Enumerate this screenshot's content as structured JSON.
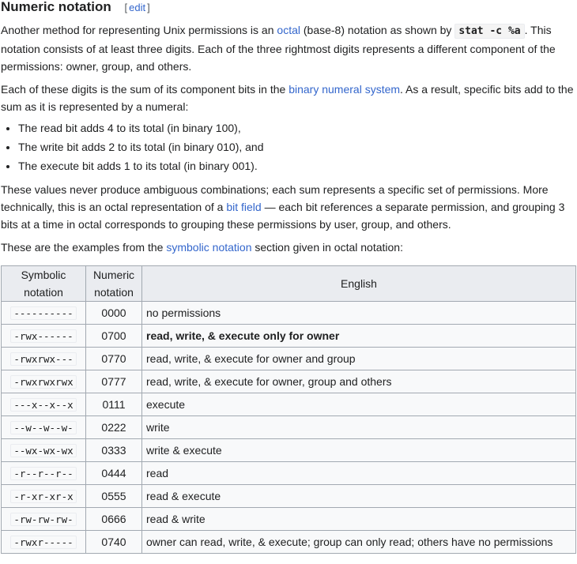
{
  "heading": {
    "title": "Numeric notation",
    "edit_open": "[",
    "edit_label": "edit",
    "edit_close": "]"
  },
  "para1": {
    "t1": "Another method for representing Unix permissions is an ",
    "link_octal": "octal",
    "t2": " (base-8) notation as shown by ",
    "code": "stat -c %a",
    "t3": ". This notation consists of at least three digits. Each of the three rightmost digits represents a different component of the permissions: owner, group, and others."
  },
  "para2": {
    "t1": "Each of these digits is the sum of its component bits in the ",
    "link_binary": "binary numeral system",
    "t2": ". As a result, specific bits add to the sum as it is represented by a numeral:"
  },
  "bullets": [
    "The read bit adds 4 to its total (in binary 100),",
    "The write bit adds 2 to its total (in binary 010), and",
    "The execute bit adds 1 to its total (in binary 001)."
  ],
  "para3": {
    "t1": "These values never produce ambiguous combinations; each sum represents a specific set of permissions. More technically, this is an octal representation of a ",
    "link_bitfield": "bit field",
    "t2": " — each bit references a separate permission, and grouping 3 bits at a time in octal corresponds to grouping these permissions by user, group, and others."
  },
  "para4": {
    "t1": "These are the examples from the ",
    "link_symbolic": "symbolic notation",
    "t2": " section given in octal notation:"
  },
  "table": {
    "headers": {
      "symbolic_1": "Symbolic",
      "symbolic_2": "notation",
      "numeric_1": "Numeric",
      "numeric_2": "notation",
      "english": "English"
    },
    "rows": [
      {
        "symbolic": "----------",
        "numeric": "0000",
        "english": "no permissions"
      },
      {
        "symbolic": "-rwx------",
        "numeric": "0700",
        "english": "read, write, & execute only for owner"
      },
      {
        "symbolic": "-rwxrwx---",
        "numeric": "0770",
        "english": "read, write, & execute for owner and group"
      },
      {
        "symbolic": "-rwxrwxrwx",
        "numeric": "0777",
        "english": "read, write, & execute for owner, group and others"
      },
      {
        "symbolic": "---x--x--x",
        "numeric": "0111",
        "english": "execute"
      },
      {
        "symbolic": "--w--w--w-",
        "numeric": "0222",
        "english": "write"
      },
      {
        "symbolic": "--wx-wx-wx",
        "numeric": "0333",
        "english": "write & execute"
      },
      {
        "symbolic": "-r--r--r--",
        "numeric": "0444",
        "english": "read"
      },
      {
        "symbolic": "-r-xr-xr-x",
        "numeric": "0555",
        "english": "read & execute"
      },
      {
        "symbolic": "-rw-rw-rw-",
        "numeric": "0666",
        "english": "read & write"
      },
      {
        "symbolic": "-rwxr-----",
        "numeric": "0740",
        "english": "owner can read, write, & execute; group can only read; others have no permissions"
      }
    ]
  }
}
